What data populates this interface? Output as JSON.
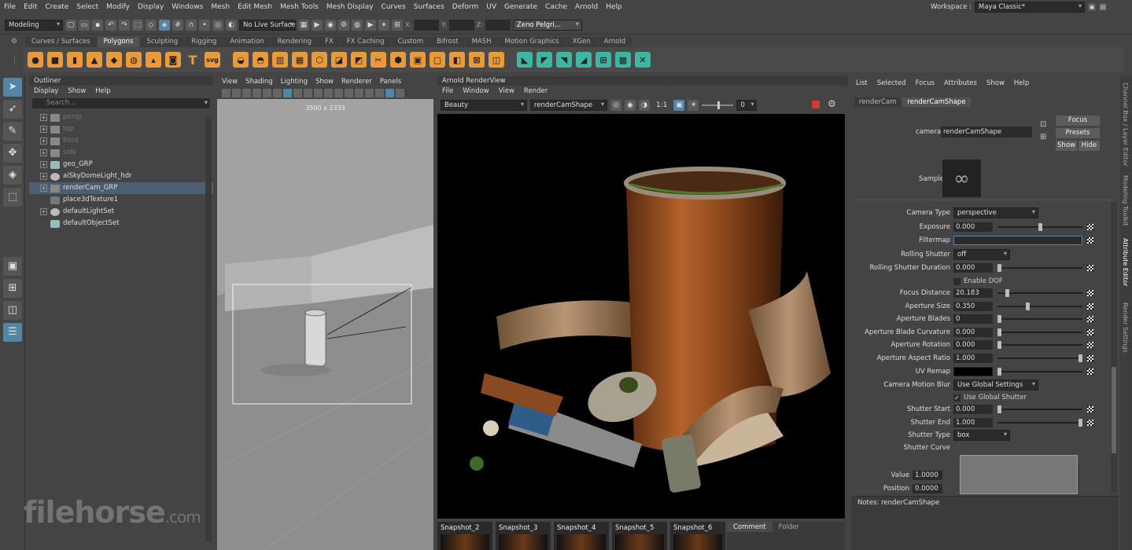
{
  "menu": [
    "File",
    "Edit",
    "Create",
    "Select",
    "Modify",
    "Display",
    "Windows",
    "Mesh",
    "Edit Mesh",
    "Mesh Tools",
    "Mesh Display",
    "Curves",
    "Surfaces",
    "Deform",
    "UV",
    "Generate",
    "Cache",
    "Arnold",
    "Help"
  ],
  "workspace": {
    "label": "Workspace :",
    "value": "Maya Classic*"
  },
  "statusline": {
    "mode": "Modeling",
    "live_surface": "No Live Surface",
    "x_label": "X:",
    "y_label": "Y:",
    "z_label": "Z:",
    "user": "Zeno Pelgri..."
  },
  "shelf_tabs": [
    "Curves / Surfaces",
    "Polygons",
    "Sculpting",
    "Rigging",
    "Animation",
    "Rendering",
    "FX",
    "FX Caching",
    "Custom",
    "Bifrost",
    "MASH",
    "Motion Graphics",
    "XGen",
    "Arnold"
  ],
  "shelf_active": "Polygons",
  "shelf_text_icons": {
    "type": "T",
    "svg": "svg"
  },
  "outliner": {
    "title": "Outliner",
    "menu": [
      "Display",
      "Show",
      "Help"
    ],
    "search_placeholder": "Search...",
    "items": [
      {
        "name": "persp",
        "dim": true,
        "plus": true
      },
      {
        "name": "top",
        "dim": true,
        "plus": true
      },
      {
        "name": "front",
        "dim": true,
        "plus": true
      },
      {
        "name": "side",
        "dim": true,
        "plus": true
      },
      {
        "name": "geo_GRP",
        "dim": false,
        "plus": true
      },
      {
        "name": "aiSkyDomeLight_hdr",
        "dim": false,
        "plus": true
      },
      {
        "name": "renderCam_GRP",
        "dim": false,
        "plus": true,
        "selected": true
      },
      {
        "name": "place3dTexture1",
        "dim": false,
        "plus": false
      },
      {
        "name": "defaultLightSet",
        "dim": false,
        "plus": true
      },
      {
        "name": "defaultObjectSet",
        "dim": false,
        "plus": false
      }
    ]
  },
  "viewport": {
    "menu": [
      "View",
      "Shading",
      "Lighting",
      "Show",
      "Renderer",
      "Panels"
    ],
    "resolution_gate": "3500 x 2333"
  },
  "renderview": {
    "title": "Arnold RenderView",
    "menu": [
      "File",
      "Window",
      "View",
      "Render"
    ],
    "aov": "Beauty",
    "camera": "renderCamShape",
    "ratio": "1:1",
    "exposure_value": "0",
    "snapshots": [
      "Snapshot_2",
      "Snapshot_3",
      "Snapshot_4",
      "Snapshot_5",
      "Snapshot_6"
    ],
    "tabs": [
      "Comment",
      "Folder"
    ]
  },
  "attribute_editor": {
    "menu": [
      "List",
      "Selected",
      "Focus",
      "Attributes",
      "Show",
      "Help"
    ],
    "tabs": [
      "renderCam",
      "renderCamShape"
    ],
    "camera_label": "camera:",
    "camera_value": "renderCamShape",
    "buttons": {
      "focus": "Focus",
      "presets": "Presets",
      "show": "Show",
      "hide": "Hide"
    },
    "sample_label": "Sample",
    "notes": "Notes:  renderCamShape",
    "attrs": [
      {
        "label": "Camera Type",
        "type": "combo",
        "value": "perspective"
      },
      {
        "label": "Exposure",
        "type": "slider",
        "value": "0.000",
        "pos": 0.5
      },
      {
        "label": "Filtermap",
        "type": "text",
        "value": ""
      },
      {
        "label": "Rolling Shutter",
        "type": "combo",
        "value": "off"
      },
      {
        "label": "Rolling Shutter Duration",
        "type": "slider",
        "value": "0.000",
        "pos": 0.0
      },
      {
        "label": "",
        "type": "check",
        "value": "Enable DOF",
        "checked": false
      },
      {
        "label": "Focus Distance",
        "type": "slider",
        "value": "20.183",
        "pos": 0.1
      },
      {
        "label": "Aperture Size",
        "type": "slider",
        "value": "0.350",
        "pos": 0.35
      },
      {
        "label": "Aperture Blades",
        "type": "slider",
        "value": "0",
        "pos": 0.0
      },
      {
        "label": "Aperture Blade Curvature",
        "type": "slider",
        "value": "0.000",
        "pos": 0.0
      },
      {
        "label": "Aperture Rotation",
        "type": "slider",
        "value": "0.000",
        "pos": 0.0
      },
      {
        "label": "Aperture Aspect Ratio",
        "type": "slider",
        "value": "1.000",
        "pos": 1.0
      },
      {
        "label": "UV Remap",
        "type": "color",
        "value": "#000000",
        "pos": 0.0
      },
      {
        "label": "Camera Motion Blur",
        "type": "combo",
        "value": "Use Global Settings"
      },
      {
        "label": "",
        "type": "check",
        "value": "Use Global Shutter",
        "checked": true
      },
      {
        "label": "Shutter Start",
        "type": "slider",
        "value": "0.000",
        "pos": 0.0
      },
      {
        "label": "Shutter End",
        "type": "slider",
        "value": "1.000",
        "pos": 1.0
      },
      {
        "label": "Shutter Type",
        "type": "combo",
        "value": "box"
      },
      {
        "label": "Shutter Curve",
        "type": "label",
        "value": ""
      }
    ],
    "curve_value_label": "Value",
    "curve_value": "1.0000",
    "curve_position_label": "Position",
    "curve_position": "0.0000"
  },
  "side_tabs": [
    "Channel Box / Layer Editor",
    "Modeling Toolkit",
    "Attribute Editor",
    "Render Settings"
  ],
  "watermark": {
    "main": "filehorse",
    "suffix": ".com"
  },
  "colors": {
    "accent": "#5285a6",
    "shelf_orange": "#e89a3c",
    "shelf_teal": "#3fb5a2",
    "render_bg": "#000000"
  }
}
